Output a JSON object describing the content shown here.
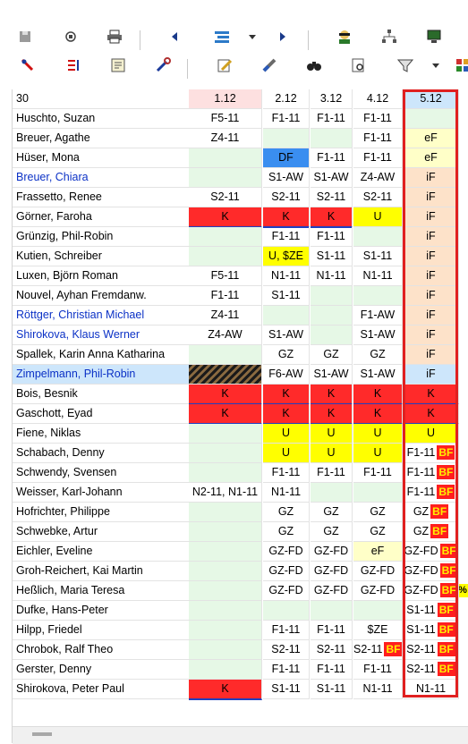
{
  "colors": {
    "red": "#ff2a2a",
    "yellow": "#ffff00",
    "green": "#e6f8e6",
    "peach": "#fde2c9",
    "lightyellow": "#ffffc8",
    "blue": "#3a8ef0",
    "pink": "#fde0e0",
    "select": "#cde6fb",
    "frame": "#e02020"
  },
  "toolbar": {
    "row1": [
      "save-icon",
      "refresh-icon",
      "print-icon",
      "prev-icon",
      "layout-icon",
      "dropdown-icon",
      "next-icon",
      "agent-icon",
      "tree-icon",
      "monitor-icon"
    ],
    "row2": [
      "pin-icon",
      "sort-icon",
      "report-icon",
      "tools-icon",
      "edit-icon",
      "wand-icon",
      "binoculars-icon",
      "preview-icon",
      "filter-icon",
      "dropdown-icon",
      "grid-icon"
    ]
  },
  "grid": {
    "corner": "30",
    "columns": [
      "1.12",
      "2.12",
      "3.12",
      "4.12",
      "5.12"
    ],
    "rows": [
      {
        "name": "Huschto, Suzan",
        "blue": false,
        "cells": [
          {
            "t": "F5-11"
          },
          {
            "t": "F1-11"
          },
          {
            "t": "F1-11"
          },
          {
            "t": "F1-11"
          },
          {
            "t": "",
            "bg": "green"
          }
        ]
      },
      {
        "name": "Breuer, Agathe",
        "blue": false,
        "cells": [
          {
            "t": "Z4-11"
          },
          {
            "t": "",
            "bg": "green"
          },
          {
            "t": "",
            "bg": "green"
          },
          {
            "t": "F1-11"
          },
          {
            "t": "eF",
            "bg": "lightyellow"
          }
        ]
      },
      {
        "name": "Hüser, Mona",
        "blue": false,
        "cells": [
          {
            "t": "",
            "bg": "green"
          },
          {
            "t": "DF",
            "bg": "blue"
          },
          {
            "t": "F1-11"
          },
          {
            "t": "F1-11"
          },
          {
            "t": "eF",
            "bg": "lightyellow"
          }
        ]
      },
      {
        "name": "Breuer, Chiara",
        "blue": true,
        "cells": [
          {
            "t": "",
            "bg": "green"
          },
          {
            "t": "S1-AW"
          },
          {
            "t": "S1-AW"
          },
          {
            "t": "Z4-AW"
          },
          {
            "t": "iF",
            "bg": "peach"
          }
        ]
      },
      {
        "name": "Frassetto, Renee",
        "blue": false,
        "cells": [
          {
            "t": "S2-11"
          },
          {
            "t": "S2-11"
          },
          {
            "t": "S2-11"
          },
          {
            "t": "S2-11"
          },
          {
            "t": "iF",
            "bg": "peach"
          }
        ]
      },
      {
        "name": "Görner, Faroha",
        "blue": false,
        "cells": [
          {
            "t": "K",
            "bg": "red"
          },
          {
            "t": "K",
            "bg": "red"
          },
          {
            "t": "K",
            "bg": "red"
          },
          {
            "t": "U",
            "bg": "yellow"
          },
          {
            "t": "iF",
            "bg": "peach"
          }
        ]
      },
      {
        "name": "Grünzig, Phil-Robin",
        "blue": false,
        "cells": [
          {
            "t": "",
            "bg": "green"
          },
          {
            "t": "F1-11"
          },
          {
            "t": "F1-11"
          },
          {
            "t": "",
            "bg": "green"
          },
          {
            "t": "iF",
            "bg": "peach"
          }
        ]
      },
      {
        "name": "Kutien, Schreiber",
        "blue": false,
        "cells": [
          {
            "t": "",
            "bg": "green"
          },
          {
            "t": "U, $ZE",
            "bg": "yellow"
          },
          {
            "t": "S1-11"
          },
          {
            "t": "S1-11"
          },
          {
            "t": "iF",
            "bg": "peach"
          }
        ]
      },
      {
        "name": "Luxen, Björn Roman",
        "blue": false,
        "cells": [
          {
            "t": "F5-11"
          },
          {
            "t": "N1-11"
          },
          {
            "t": "N1-11"
          },
          {
            "t": "N1-11"
          },
          {
            "t": "iF",
            "bg": "peach"
          }
        ]
      },
      {
        "name": "Nouvel, Ayhan Fremdanw.",
        "blue": false,
        "cells": [
          {
            "t": "F1-11"
          },
          {
            "t": "S1-11"
          },
          {
            "t": "",
            "bg": "green"
          },
          {
            "t": "",
            "bg": "green"
          },
          {
            "t": "iF",
            "bg": "peach"
          }
        ]
      },
      {
        "name": "Röttger, Christian Michael",
        "blue": true,
        "cells": [
          {
            "t": "Z4-11"
          },
          {
            "t": "",
            "bg": "green"
          },
          {
            "t": "",
            "bg": "green"
          },
          {
            "t": "F1-AW"
          },
          {
            "t": "iF",
            "bg": "peach"
          }
        ]
      },
      {
        "name": "Shirokova, Klaus Werner",
        "blue": true,
        "cells": [
          {
            "t": "Z4-AW"
          },
          {
            "t": "S1-AW"
          },
          {
            "t": "",
            "bg": "green"
          },
          {
            "t": "S1-AW"
          },
          {
            "t": "iF",
            "bg": "peach"
          }
        ]
      },
      {
        "name": "Spallek, Karin Anna Katharina",
        "blue": false,
        "cells": [
          {
            "t": "",
            "bg": "green"
          },
          {
            "t": "GZ"
          },
          {
            "t": "GZ"
          },
          {
            "t": "GZ"
          },
          {
            "t": "iF",
            "bg": "peach"
          }
        ]
      },
      {
        "name": "Zimpelmann, Phil-Robin",
        "blue": true,
        "selected": true,
        "cells": [
          {
            "t": "",
            "bg": "hatch"
          },
          {
            "t": "F6-AW"
          },
          {
            "t": "S1-AW"
          },
          {
            "t": "S1-AW"
          },
          {
            "t": "iF",
            "bg": "select"
          }
        ]
      },
      {
        "name": "Bois, Besnik",
        "blue": false,
        "cells": [
          {
            "t": "K",
            "bg": "red"
          },
          {
            "t": "K",
            "bg": "red"
          },
          {
            "t": "K",
            "bg": "red"
          },
          {
            "t": "K",
            "bg": "red"
          },
          {
            "t": "K",
            "bg": "red"
          }
        ]
      },
      {
        "name": "Gaschott, Eyad",
        "blue": false,
        "cells": [
          {
            "t": "K",
            "bg": "red"
          },
          {
            "t": "K",
            "bg": "red"
          },
          {
            "t": "K",
            "bg": "red"
          },
          {
            "t": "K",
            "bg": "red"
          },
          {
            "t": "K",
            "bg": "red"
          }
        ]
      },
      {
        "name": "Fiene, Niklas",
        "blue": false,
        "cells": [
          {
            "t": "",
            "bg": "green"
          },
          {
            "t": "U",
            "bg": "yellow"
          },
          {
            "t": "U",
            "bg": "yellow"
          },
          {
            "t": "U",
            "bg": "yellow"
          },
          {
            "t": "U",
            "bg": "yellow"
          }
        ]
      },
      {
        "name": "Schabach, Denny",
        "blue": false,
        "cells": [
          {
            "t": "",
            "bg": "green"
          },
          {
            "t": "U",
            "bg": "yellow"
          },
          {
            "t": "U",
            "bg": "yellow"
          },
          {
            "t": "U",
            "bg": "yellow"
          },
          {
            "t": "F1-11",
            "bf": "BF"
          }
        ]
      },
      {
        "name": "Schwendy, Svensen",
        "blue": false,
        "cells": [
          {
            "t": "",
            "bg": "green"
          },
          {
            "t": "F1-11"
          },
          {
            "t": "F1-11"
          },
          {
            "t": "F1-11"
          },
          {
            "t": "F1-11",
            "bf": "BF"
          }
        ]
      },
      {
        "name": "Weisser, Karl-Johann",
        "blue": false,
        "cells": [
          {
            "t": "N2-11, N1-11"
          },
          {
            "t": "N1-11"
          },
          {
            "t": "",
            "bg": "green"
          },
          {
            "t": "",
            "bg": "green"
          },
          {
            "t": "F1-11",
            "bf": "BF"
          }
        ]
      },
      {
        "name": "Hofrichter, Philippe",
        "blue": false,
        "cells": [
          {
            "t": "",
            "bg": "green"
          },
          {
            "t": "GZ"
          },
          {
            "t": "GZ"
          },
          {
            "t": "GZ"
          },
          {
            "t": "GZ",
            "bf": "BF"
          }
        ]
      },
      {
        "name": "Schwebke, Artur",
        "blue": false,
        "cells": [
          {
            "t": "",
            "bg": "green"
          },
          {
            "t": "GZ"
          },
          {
            "t": "GZ"
          },
          {
            "t": "GZ"
          },
          {
            "t": "GZ",
            "bf": "BF"
          }
        ]
      },
      {
        "name": "Eichler, Eveline",
        "blue": false,
        "cells": [
          {
            "t": "",
            "bg": "green"
          },
          {
            "t": "GZ-FD"
          },
          {
            "t": "GZ-FD"
          },
          {
            "t": "eF",
            "bg": "lightyellow"
          },
          {
            "t": "GZ-FD",
            "bf": "BF"
          }
        ]
      },
      {
        "name": "Groh-Reichert, Kai Martin",
        "blue": false,
        "cells": [
          {
            "t": "",
            "bg": "green"
          },
          {
            "t": "GZ-FD"
          },
          {
            "t": "GZ-FD"
          },
          {
            "t": "GZ-FD"
          },
          {
            "t": "GZ-FD",
            "bf": "BF"
          }
        ]
      },
      {
        "name": "Heßlich, Maria Teresa",
        "blue": false,
        "pct": "%",
        "cells": [
          {
            "t": "",
            "bg": "green"
          },
          {
            "t": "GZ-FD"
          },
          {
            "t": "GZ-FD"
          },
          {
            "t": "GZ-FD"
          },
          {
            "t": "GZ-FD",
            "bf": "BF"
          }
        ]
      },
      {
        "name": "Dufke, Hans-Peter",
        "blue": false,
        "cells": [
          {
            "t": "",
            "bg": "green"
          },
          {
            "t": "",
            "bg": "green"
          },
          {
            "t": "",
            "bg": "green"
          },
          {
            "t": "",
            "bg": "green"
          },
          {
            "t": "S1-11",
            "bf": "BF"
          }
        ]
      },
      {
        "name": "Hilpp, Friedel",
        "blue": false,
        "cells": [
          {
            "t": "",
            "bg": "green"
          },
          {
            "t": "F1-11"
          },
          {
            "t": "F1-11"
          },
          {
            "t": "$ZE"
          },
          {
            "t": "S1-11",
            "bf": "BF"
          }
        ]
      },
      {
        "name": "Chrobok, Ralf Theo",
        "blue": false,
        "cells": [
          {
            "t": "",
            "bg": "green"
          },
          {
            "t": "S2-11"
          },
          {
            "t": "S2-11"
          },
          {
            "t": "S2-11",
            "bf": "BF"
          },
          {
            "t": "S2-11",
            "bf": "BF"
          }
        ]
      },
      {
        "name": "Gerster, Denny",
        "blue": false,
        "cells": [
          {
            "t": "",
            "bg": "green"
          },
          {
            "t": "F1-11"
          },
          {
            "t": "F1-11"
          },
          {
            "t": "F1-11"
          },
          {
            "t": "S2-11",
            "bf": "BF"
          }
        ]
      },
      {
        "name": "Shirokova, Peter Paul",
        "blue": false,
        "cells": [
          {
            "t": "K",
            "bg": "red"
          },
          {
            "t": "S1-11"
          },
          {
            "t": "S1-11"
          },
          {
            "t": "N1-11"
          },
          {
            "t": "N1-11"
          }
        ]
      }
    ]
  }
}
